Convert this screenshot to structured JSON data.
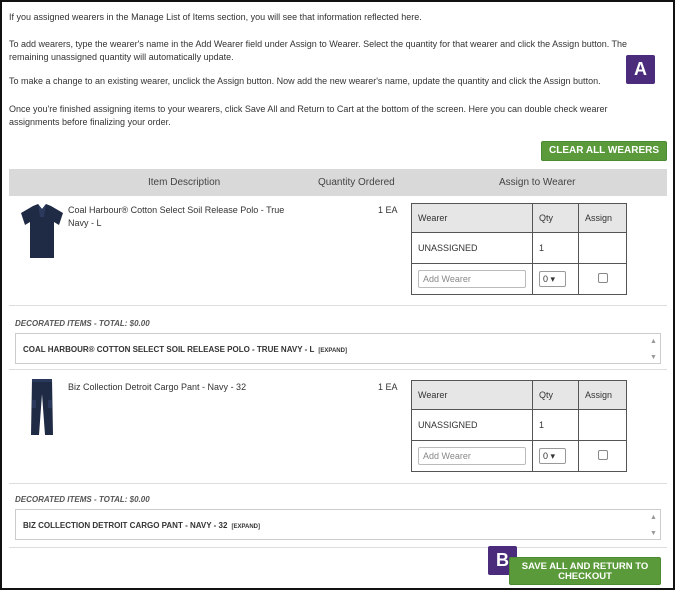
{
  "instructions": [
    "If you assigned wearers in the Manage List of Items section, you will see that information reflected here.",
    "To add wearers, type the wearer's name in the Add Wearer field under Assign to Wearer. Select the quantity for that wearer and click the Assign button. The remaining unassigned quantity will automatically update.",
    "To make a change to an existing wearer, unclick the Assign button. Now add the new wearer's name, update the quantity and click the Assign button.",
    "Once you're finished assigning items to your wearers, click Save All and Return to Cart at the bottom of the screen. Here you can double check wearer assignments before finalizing your order."
  ],
  "markers": {
    "a": "A",
    "b": "B"
  },
  "buttons": {
    "clear_all": "CLEAR ALL WEARERS",
    "save_all": "SAVE ALL AND RETURN TO CHECKOUT"
  },
  "table_headers": {
    "item_description": "Item Description",
    "quantity_ordered": "Quantity Ordered",
    "assign_to_wearer": "Assign to Wearer"
  },
  "wearer_table_headers": {
    "wearer": "Wearer",
    "qty": "Qty",
    "assign": "Assign"
  },
  "items": [
    {
      "description": "Coal Harbour® Cotton Select Soil Release Polo - True Navy - L",
      "quantity": "1 EA",
      "unassigned_label": "UNASSIGNED",
      "unassigned_qty": "1",
      "add_wearer_placeholder": "Add Wearer",
      "qty_select": "0",
      "decorated_label": "DECORATED ITEMS",
      "decorated_total": "- TOTAL: $0.00",
      "decorated_item": "COAL HARBOUR® COTTON SELECT SOIL RELEASE POLO - TRUE NAVY - L",
      "expand": "[EXPAND]",
      "icon": "navy-polo-shirt"
    },
    {
      "description": "Biz Collection Detroit Cargo Pant - Navy - 32",
      "quantity": "1 EA",
      "unassigned_label": "UNASSIGNED",
      "unassigned_qty": "1",
      "add_wearer_placeholder": "Add Wearer",
      "qty_select": "0",
      "decorated_label": "DECORATED ITEMS",
      "decorated_total": "- TOTAL: $0.00",
      "decorated_item": "BIZ COLLECTION DETROIT CARGO PANT - NAVY - 32",
      "expand": "[EXPAND]",
      "icon": "navy-cargo-pants"
    }
  ],
  "colors": {
    "marker": "#4a2b7c",
    "button_green": "#5a9a3a",
    "header_gray": "#d9d9d9",
    "navy": "#1f2a44"
  }
}
